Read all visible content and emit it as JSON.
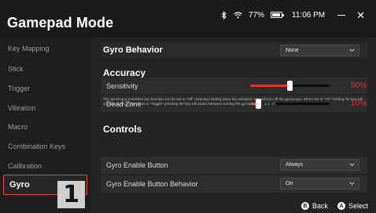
{
  "window": {
    "title": "Gamepad Mode",
    "battery_percent": "77%",
    "time": "11:06 PM",
    "bluetooth_icon": "bluetooth-icon",
    "wifi_icon": "wifi-icon",
    "battery_level": 0.77
  },
  "sidebar": {
    "items": [
      {
        "label": "Key Mapping"
      },
      {
        "label": "Stick"
      },
      {
        "label": "Trigger"
      },
      {
        "label": "Vibration"
      },
      {
        "label": "Macro"
      },
      {
        "label": "Combination Keys"
      },
      {
        "label": "Calibration"
      },
      {
        "label": "Gyro"
      }
    ],
    "active_index": 7,
    "badge": "1"
  },
  "gyro_behavior": {
    "label": "Gyro Behavior",
    "value": "None"
  },
  "accuracy": {
    "heading": "Accuracy",
    "sensitivity": {
      "label": "Sensitivity",
      "value": "50%",
      "level": 0.5
    },
    "dead_zone": {
      "label": "Dead Zone",
      "value": "10%",
      "level": 0.1
    }
  },
  "controls": {
    "heading": "Controls",
    "description": "The gyroscope activation key function can be set to \"Off\" meaning holding down the activation key will turn off the gyroscope. When set to \"On\" holding the key will activate the function. If set to \"Toggle\" pressing the key will switch between turning the gyroscope on and off.",
    "enable_button": {
      "label": "Gyro Enable Button",
      "value": "Always"
    },
    "enable_button_behavior": {
      "label": "Gyro Enable Button Behavior",
      "value": "On"
    }
  },
  "footer": {
    "back": {
      "button": "B",
      "label": "Back"
    },
    "select": {
      "button": "A",
      "label": "Select"
    }
  },
  "colors": {
    "accent": "#e6332a",
    "active_border": "#e04a3c"
  }
}
